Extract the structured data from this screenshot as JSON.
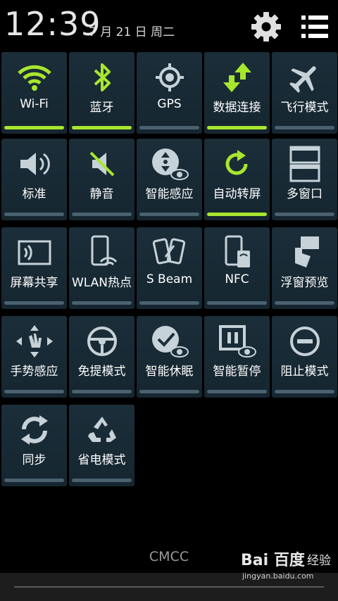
{
  "status": {
    "time": "12:39",
    "date": "7 月 21 日 周二"
  },
  "colors": {
    "accent_on": "#a8e62e",
    "icon": "#c6d2d8",
    "tile_bg": "#1b2e39"
  },
  "header": {
    "settings_icon": "gear-icon",
    "menu_icon": "list-icon"
  },
  "tiles": [
    {
      "label": "Wi-Fi",
      "icon": "wifi-icon",
      "on": true
    },
    {
      "label": "蓝牙",
      "icon": "bluetooth-icon",
      "on": true
    },
    {
      "label": "GPS",
      "icon": "gps-icon",
      "on": false
    },
    {
      "label": "数据连接",
      "icon": "data-transfer-icon",
      "on": true
    },
    {
      "label": "飞行模式",
      "icon": "airplane-icon",
      "on": false
    },
    {
      "label": "标准",
      "icon": "volume-icon",
      "on": false
    },
    {
      "label": "静音",
      "icon": "mute-icon",
      "on": false
    },
    {
      "label": "智能感应",
      "icon": "smart-stay-icon",
      "on": false
    },
    {
      "label": "自动转屏",
      "icon": "rotate-icon",
      "on": true
    },
    {
      "label": "多窗口",
      "icon": "multi-window-icon",
      "on": false
    },
    {
      "label": "屏幕共享",
      "icon": "screen-mirroring-icon",
      "on": false
    },
    {
      "label": "WLAN热点",
      "icon": "hotspot-icon",
      "on": false
    },
    {
      "label": "S Beam",
      "icon": "s-beam-icon",
      "on": false
    },
    {
      "label": "NFC",
      "icon": "nfc-icon",
      "on": false
    },
    {
      "label": "浮窗预览",
      "icon": "air-view-icon",
      "on": false
    },
    {
      "label": "手势感应",
      "icon": "gesture-icon",
      "on": false
    },
    {
      "label": "免提模式",
      "icon": "steering-wheel-icon",
      "on": false
    },
    {
      "label": "智能休眠",
      "icon": "smart-sleep-icon",
      "on": false
    },
    {
      "label": "智能暂停",
      "icon": "smart-pause-icon",
      "on": false
    },
    {
      "label": "阻止模式",
      "icon": "block-icon",
      "on": false
    },
    {
      "label": "同步",
      "icon": "sync-icon",
      "on": false
    },
    {
      "label": "省电模式",
      "icon": "recycle-icon",
      "on": false
    }
  ],
  "footer": {
    "carrier": "CMCC"
  },
  "watermark": {
    "brand": "Bai 百度",
    "sub": "经验",
    "url": "jingyan.baidu.com"
  }
}
